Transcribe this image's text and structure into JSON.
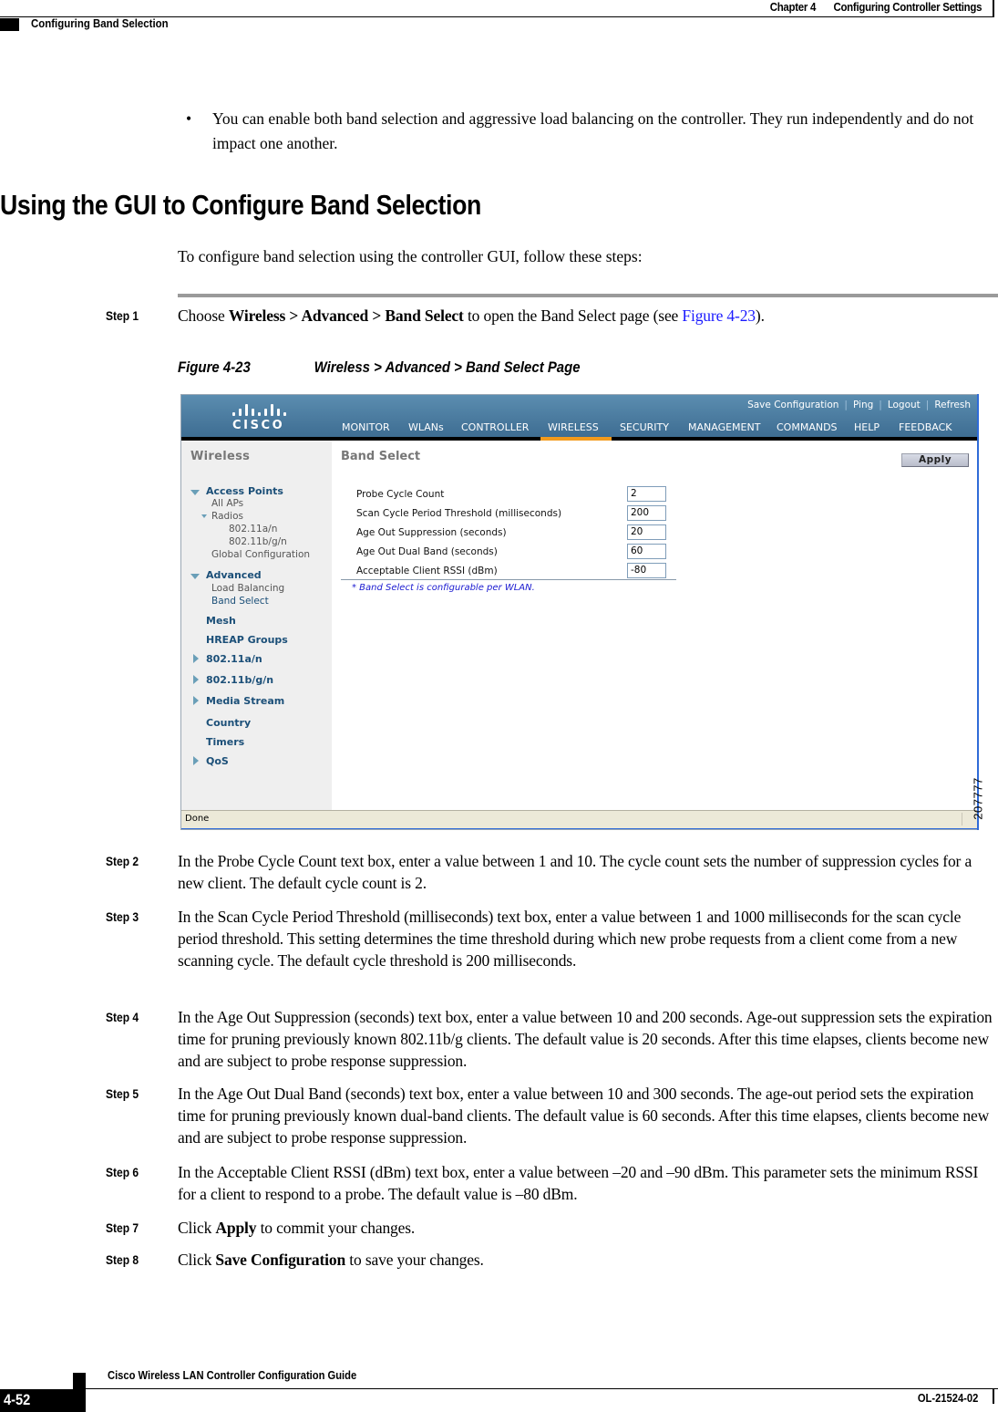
{
  "header": {
    "chapter": "Chapter 4",
    "chapter_title": "Configuring Controller Settings",
    "section": "Configuring Band Selection"
  },
  "bullet": {
    "symbol": "•",
    "text": "You can enable both band selection and aggressive load balancing on the controller. They run independently and do not impact one another."
  },
  "heading": "Using the GUI to Configure Band Selection",
  "intro": "To configure band selection using the controller GUI, follow these steps:",
  "steps": [
    {
      "label": "Step 1",
      "parts": {
        "t1": "Choose ",
        "b1": "Wireless > Advanced > Band Select",
        "t2": " to open the Band Select page (see ",
        "link": "Figure 4-23",
        "t3": ")."
      }
    },
    {
      "label": "Step 2",
      "text": "In the Probe Cycle Count text box, enter a value between 1 and 10. The cycle count sets the number of suppression cycles for a new client. The default cycle count is 2."
    },
    {
      "label": "Step 3",
      "text": "In the Scan Cycle Period Threshold (milliseconds) text box, enter a value between 1 and 1000 milliseconds for the scan cycle period threshold. This setting determines the time threshold during which new probe requests from a client come from a new scanning cycle. The default cycle threshold is 200 milliseconds."
    },
    {
      "label": "Step 4",
      "text": "In the Age Out Suppression (seconds) text box, enter a value between 10 and 200 seconds. Age-out suppression sets the expiration time for pruning previously known 802.11b/g clients. The default value is 20 seconds. After this time elapses, clients become new and are subject to probe response suppression."
    },
    {
      "label": "Step 5",
      "text": "In the Age Out Dual Band (seconds) text box, enter a value between 10 and 300 seconds. The age-out period sets the expiration time for pruning previously known dual-band clients. The default value is 60 seconds. After this time elapses, clients become new and are subject to probe response suppression."
    },
    {
      "label": "Step 6",
      "text": "In the Acceptable Client RSSI (dBm) text box, enter a value between –20 and –90 dBm. This parameter sets the minimum RSSI for a client to respond to a probe. The default value is –80 dBm."
    },
    {
      "label": "Step 7",
      "parts": {
        "t1": "Click ",
        "b1": "Apply",
        "t2": " to commit your changes."
      }
    },
    {
      "label": "Step 8",
      "parts": {
        "t1": "Click ",
        "b1": "Save Configuration",
        "t2": " to save your changes."
      }
    }
  ],
  "figure": {
    "number": "Figure 4-23",
    "title": "Wireless > Advanced > Band Select Page",
    "id": "207777",
    "gui": {
      "logo_text": "CISCO",
      "top_links": [
        "Save Configuration",
        "Ping",
        "Logout",
        "Refresh"
      ],
      "nav": [
        "MONITOR",
        "WLANs",
        "CONTROLLER",
        "WIRELESS",
        "SECURITY",
        "MANAGEMENT",
        "COMMANDS",
        "HELP",
        "FEEDBACK"
      ],
      "nav_active": "WIRELESS",
      "colors": {
        "topbar": "#4a7ca1",
        "active_tab": "#f39a1c",
        "link_blue": "#1b4f78"
      },
      "sidebar": {
        "title": "Wireless",
        "items": [
          {
            "label": "Access Points",
            "type": "main",
            "expanded": true
          },
          {
            "label": "All APs",
            "type": "sub"
          },
          {
            "label": "Radios",
            "type": "sub",
            "expanded": true
          },
          {
            "label": "802.11a/n",
            "type": "subsub"
          },
          {
            "label": "802.11b/g/n",
            "type": "subsub"
          },
          {
            "label": "Global Configuration",
            "type": "sub"
          },
          {
            "label": "Advanced",
            "type": "main",
            "expanded": true
          },
          {
            "label": "Load Balancing",
            "type": "sub"
          },
          {
            "label": "Band Select",
            "type": "sub",
            "selected": true
          },
          {
            "label": "Mesh",
            "type": "main"
          },
          {
            "label": "HREAP Groups",
            "type": "main"
          },
          {
            "label": "802.11a/n",
            "type": "main",
            "collapsed": true
          },
          {
            "label": "802.11b/g/n",
            "type": "main",
            "collapsed": true
          },
          {
            "label": "Media Stream",
            "type": "main",
            "collapsed": true
          },
          {
            "label": "Country",
            "type": "main"
          },
          {
            "label": "Timers",
            "type": "main"
          },
          {
            "label": "QoS",
            "type": "main",
            "collapsed": true
          }
        ]
      },
      "content": {
        "title": "Band Select",
        "apply_label": "Apply",
        "fields": [
          {
            "label": "Probe Cycle Count",
            "value": "2"
          },
          {
            "label": "Scan Cycle Period Threshold (milliseconds)",
            "value": "200"
          },
          {
            "label": "Age Out Suppression (seconds)",
            "value": "20"
          },
          {
            "label": "Age Out Dual Band (seconds)",
            "value": "60"
          },
          {
            "label": "Acceptable Client RSSI (dBm)",
            "value": "-80"
          }
        ],
        "note": "* Band Select is configurable per WLAN."
      },
      "status_text": "Done"
    }
  },
  "footer": {
    "guide_title": "Cisco Wireless LAN Controller Configuration Guide",
    "page": "4-52",
    "doc_number": "OL-21524-02"
  }
}
